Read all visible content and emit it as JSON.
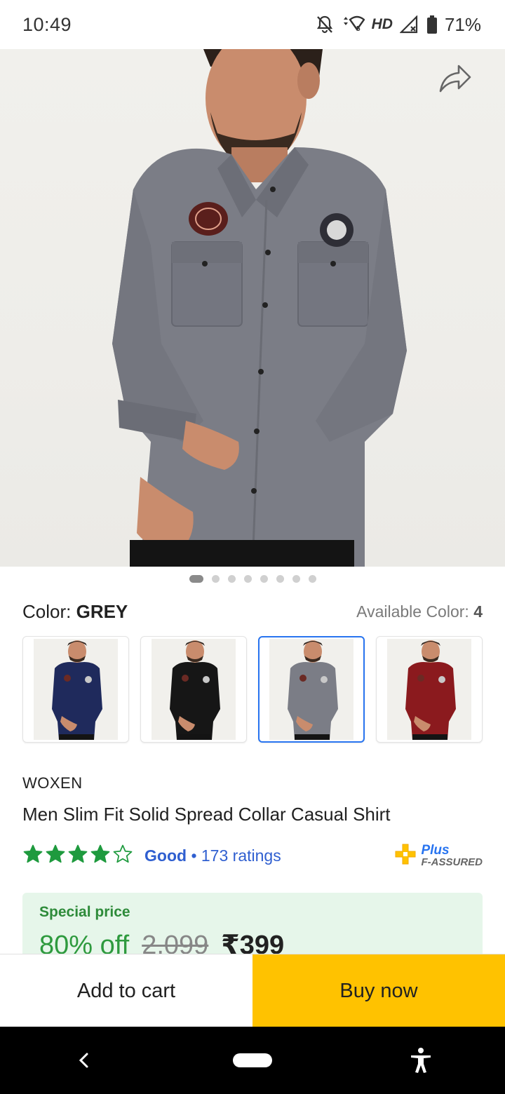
{
  "status_bar": {
    "time": "10:49",
    "network_label": "HD",
    "battery": "71%",
    "icons": [
      "notifications-off-icon",
      "data-arrows-icon",
      "wifi-icon",
      "signal-icon",
      "battery-icon"
    ]
  },
  "hero": {
    "share_icon": "share-icon",
    "image_description_icon": "shirt-image"
  },
  "carousel": {
    "count": 8,
    "active_index": 0
  },
  "color": {
    "label": "Color:",
    "value": "GREY",
    "available_label": "Available Color:",
    "available_count": "4"
  },
  "swatches": [
    {
      "name": "navy",
      "shirt_color": "#1f2a5c",
      "selected": false
    },
    {
      "name": "black",
      "shirt_color": "#161616",
      "selected": false
    },
    {
      "name": "grey",
      "shirt_color": "#7b7d86",
      "selected": true
    },
    {
      "name": "maroon",
      "shirt_color": "#8b1a1e",
      "selected": false
    }
  ],
  "product": {
    "brand": "WOXEN",
    "title": "Men Slim Fit Solid Spread Collar Casual Shirt"
  },
  "rating": {
    "stars_filled": 4,
    "stars_total": 5,
    "label": "Good",
    "separator": "•",
    "count": "173 ratings",
    "assured_plus": "Plus",
    "assured_sub": "F-ASSURED"
  },
  "price": {
    "special_label": "Special price",
    "discount": "80% off",
    "mrp": "2,099",
    "final": "₹399"
  },
  "actions": {
    "add_to_cart": "Add to cart",
    "buy_now": "Buy now"
  },
  "colors": {
    "accent_blue": "#2874f0",
    "buy_yellow": "#ffc200",
    "star_green": "#1e9a3e",
    "price_green": "#2e9a3e"
  },
  "nav": {
    "back_icon": "back-icon",
    "home_icon": "home-pill-icon",
    "accessibility_icon": "accessibility-icon"
  }
}
